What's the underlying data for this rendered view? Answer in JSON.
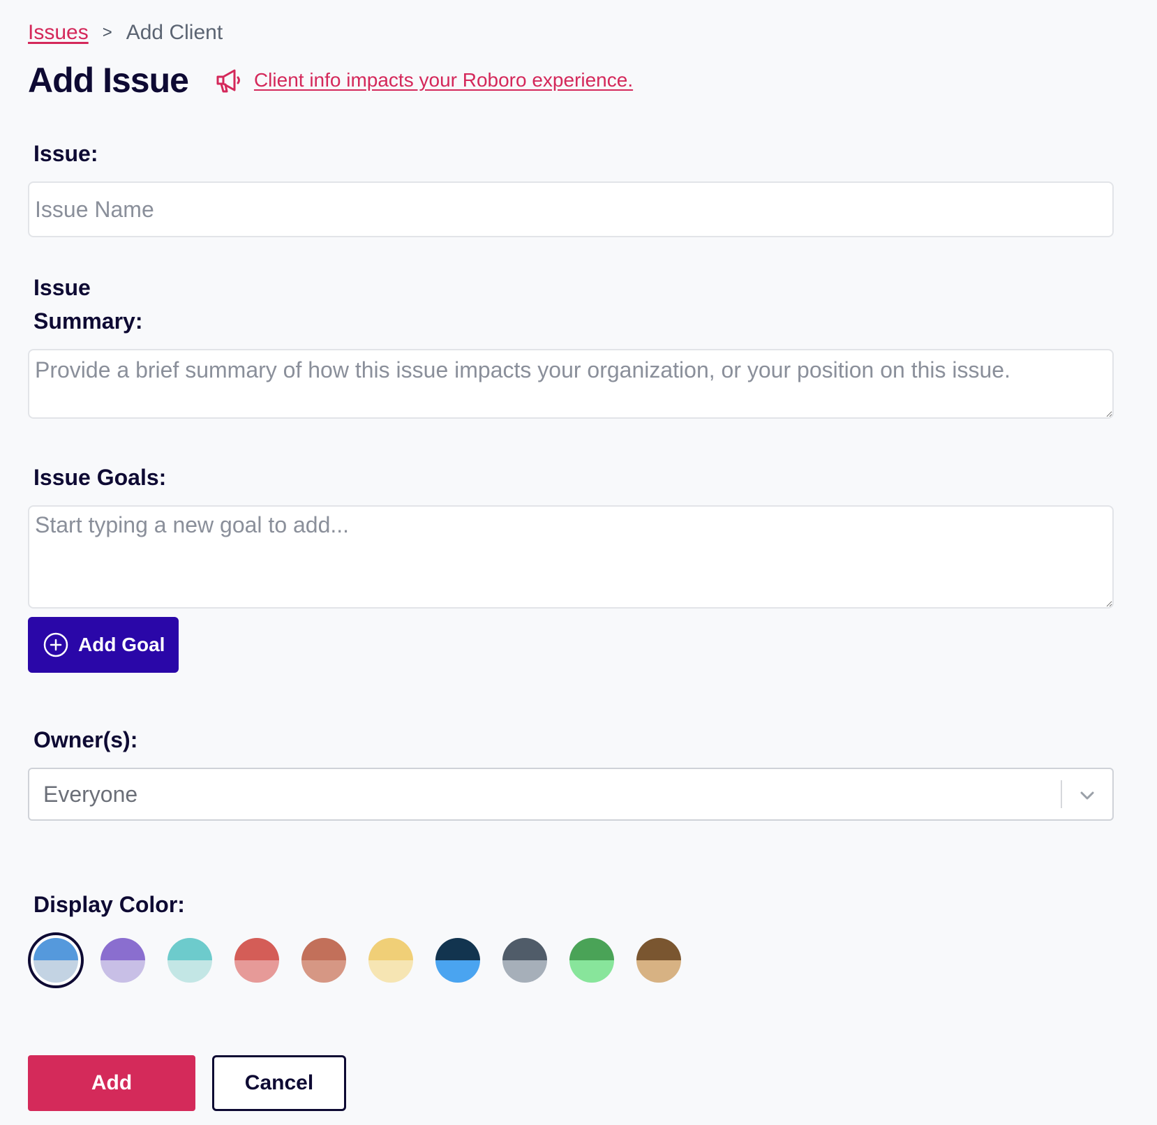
{
  "breadcrumb": {
    "parent": "Issues",
    "separator": ">",
    "current": "Add Client"
  },
  "header": {
    "title": "Add Issue",
    "info_link": "Client info impacts your Roboro experience.",
    "icon": "megaphone-icon"
  },
  "form": {
    "issue_label": "Issue:",
    "issue_placeholder": "Issue Name",
    "issue_value": "",
    "summary_label": "Issue Summary:",
    "summary_placeholder": "Provide a brief summary of how this issue impacts your organization, or your position on this issue.",
    "goals_label": "Issue Goals:",
    "goals_placeholder": "Start typing a new goal to add...",
    "add_goal_label": "Add Goal",
    "owner_label": "Owner(s):",
    "owner_value": "Everyone",
    "color_label": "Display Color:",
    "colors": [
      {
        "top": "#5599dc",
        "bottom": "#c3d3e3",
        "selected": true
      },
      {
        "top": "#8a6ecf",
        "bottom": "#c8bfe6",
        "selected": false
      },
      {
        "top": "#6dcbcc",
        "bottom": "#c3e6e5",
        "selected": false
      },
      {
        "top": "#d45d57",
        "bottom": "#e69a98",
        "selected": false
      },
      {
        "top": "#c2705a",
        "bottom": "#d69784",
        "selected": false
      },
      {
        "top": "#f0cf77",
        "bottom": "#f6e5b3",
        "selected": false
      },
      {
        "top": "#12344f",
        "bottom": "#4aa4f0",
        "selected": false
      },
      {
        "top": "#505c69",
        "bottom": "#a6afb9",
        "selected": false
      },
      {
        "top": "#4aa357",
        "bottom": "#88e59b",
        "selected": false
      },
      {
        "top": "#7a5630",
        "bottom": "#d7b283",
        "selected": false
      }
    ]
  },
  "actions": {
    "add_label": "Add",
    "cancel_label": "Cancel"
  },
  "theme": {
    "accent": "#d42a5a",
    "primary_button": "#2a07a8",
    "text": "#0e0a33"
  }
}
